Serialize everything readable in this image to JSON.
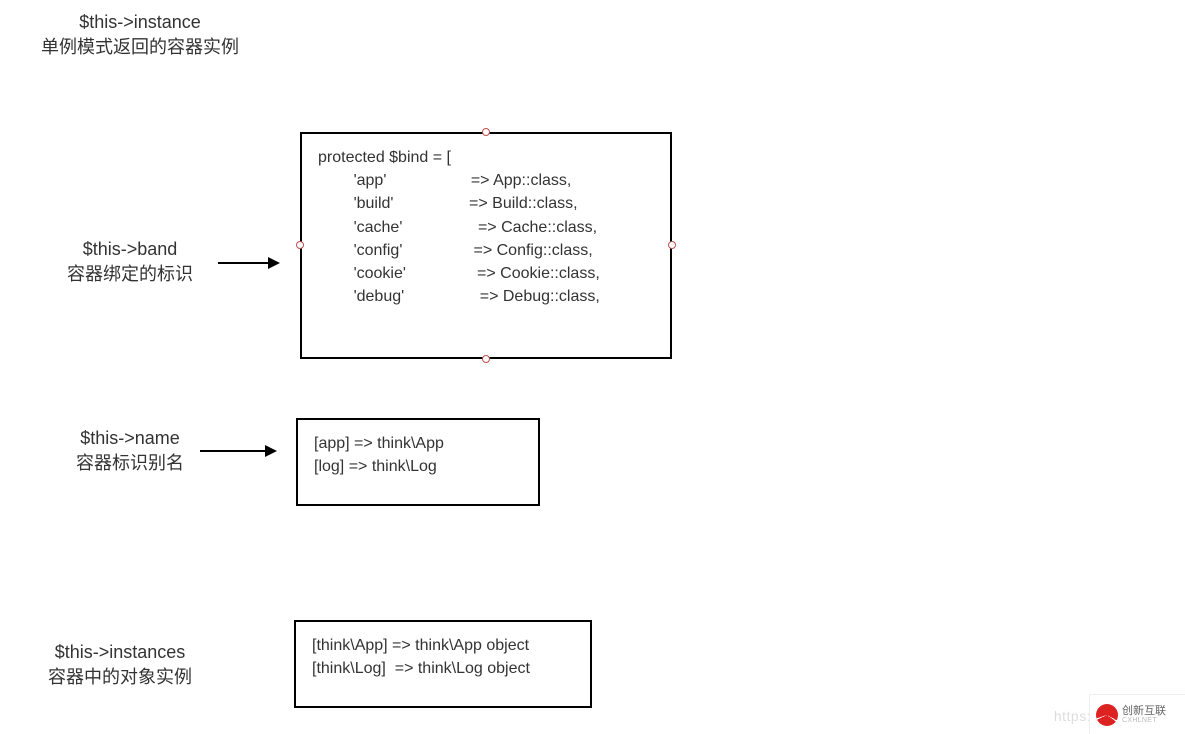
{
  "labels": {
    "instance": {
      "var": "$this->instance",
      "desc": "单例模式返回的容器实例"
    },
    "bind": {
      "var": "$this->band",
      "desc": "容器绑定的标识"
    },
    "name": {
      "var": "$this->name",
      "desc": "容器标识别名"
    },
    "instances": {
      "var": "$this->instances",
      "desc": "容器中的对象实例"
    }
  },
  "boxes": {
    "bind_code": "protected $bind = [\n        'app'                   => App::class,\n        'build'                 => Build::class,\n        'cache'                 => Cache::class,\n        'config'                => Config::class,\n        'cookie'                => Cookie::class,\n        'debug'                 => Debug::class,",
    "name_code": "[app] => think\\App\n[log] => think\\Log",
    "inst_code": "[think\\App] => think\\App object\n[think\\Log]  => think\\Log object"
  },
  "watermark": "https://blog.csdn.n",
  "logo": {
    "name": "创新互联",
    "sub": "CXHLNET"
  }
}
